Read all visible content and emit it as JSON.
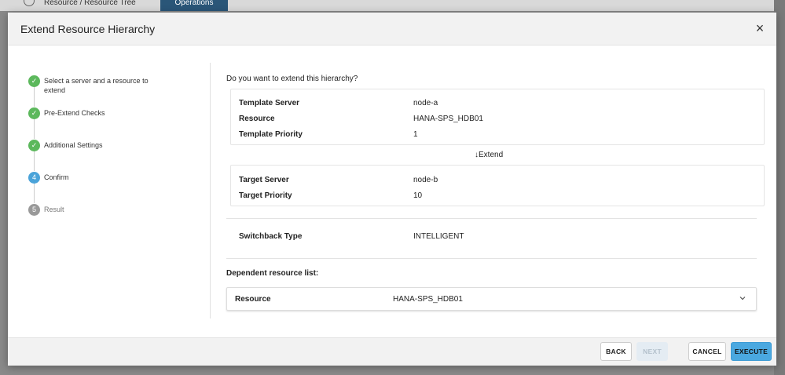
{
  "background": {
    "breadcrumb": "Resource / Resource Tree",
    "tab": "Operations"
  },
  "dialog": {
    "title": "Extend Resource Hierarchy",
    "close_symbol": "×"
  },
  "steps": [
    {
      "number": "1",
      "label": "Select a server and a resource to extend",
      "state": "done"
    },
    {
      "number": "2",
      "label": "Pre-Extend Checks",
      "state": "done"
    },
    {
      "number": "3",
      "label": "Additional Settings",
      "state": "done"
    },
    {
      "number": "4",
      "label": "Confirm",
      "state": "active"
    },
    {
      "number": "5",
      "label": "Result",
      "state": "pending"
    }
  ],
  "main": {
    "question": "Do you want to extend this hierarchy?",
    "template": {
      "server_label": "Template Server",
      "server_value": "node-a",
      "resource_label": "Resource",
      "resource_value": "HANA-SPS_HDB01",
      "priority_label": "Template Priority",
      "priority_value": "1"
    },
    "extend_label": "↓Extend",
    "target": {
      "server_label": "Target Server",
      "server_value": "node-b",
      "priority_label": "Target Priority",
      "priority_value": "10"
    },
    "switchback": {
      "label": "Switchback Type",
      "value": "INTELLIGENT"
    },
    "dependent": {
      "title": "Dependent resource list:",
      "row_label": "Resource",
      "row_value": "HANA-SPS_HDB01"
    }
  },
  "footer": {
    "back": "BACK",
    "next": "NEXT",
    "cancel": "CANCEL",
    "execute": "EXECUTE"
  },
  "colors": {
    "done": "#5cb85c",
    "active": "#4aa3d9",
    "primary": "#4aa8e0"
  }
}
